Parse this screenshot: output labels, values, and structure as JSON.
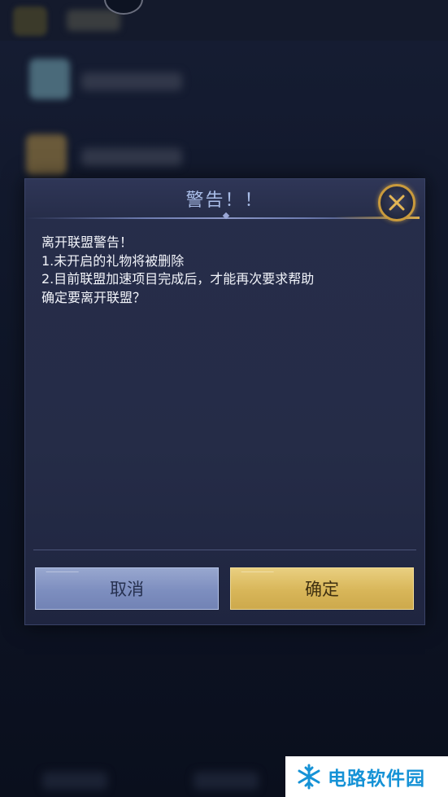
{
  "dialog": {
    "title": "警告！！",
    "message_lines": [
      "离开联盟警告！",
      "1.未开启的礼物将被删除",
      "2.目前联盟加速项目完成后，才能再次要求帮助",
      "确定要离开联盟？"
    ],
    "cancel_label": "取消",
    "confirm_label": "确定",
    "close_icon": "close-icon"
  },
  "watermark": {
    "text": "电路软件园",
    "icon": "snowflake-logo-icon"
  },
  "colors": {
    "title": "#a9bde8",
    "cancel_button": "#8797c6",
    "confirm_button": "#d9b75b",
    "close_ring": "#c99a3c",
    "watermark_text": "#1592d6"
  }
}
